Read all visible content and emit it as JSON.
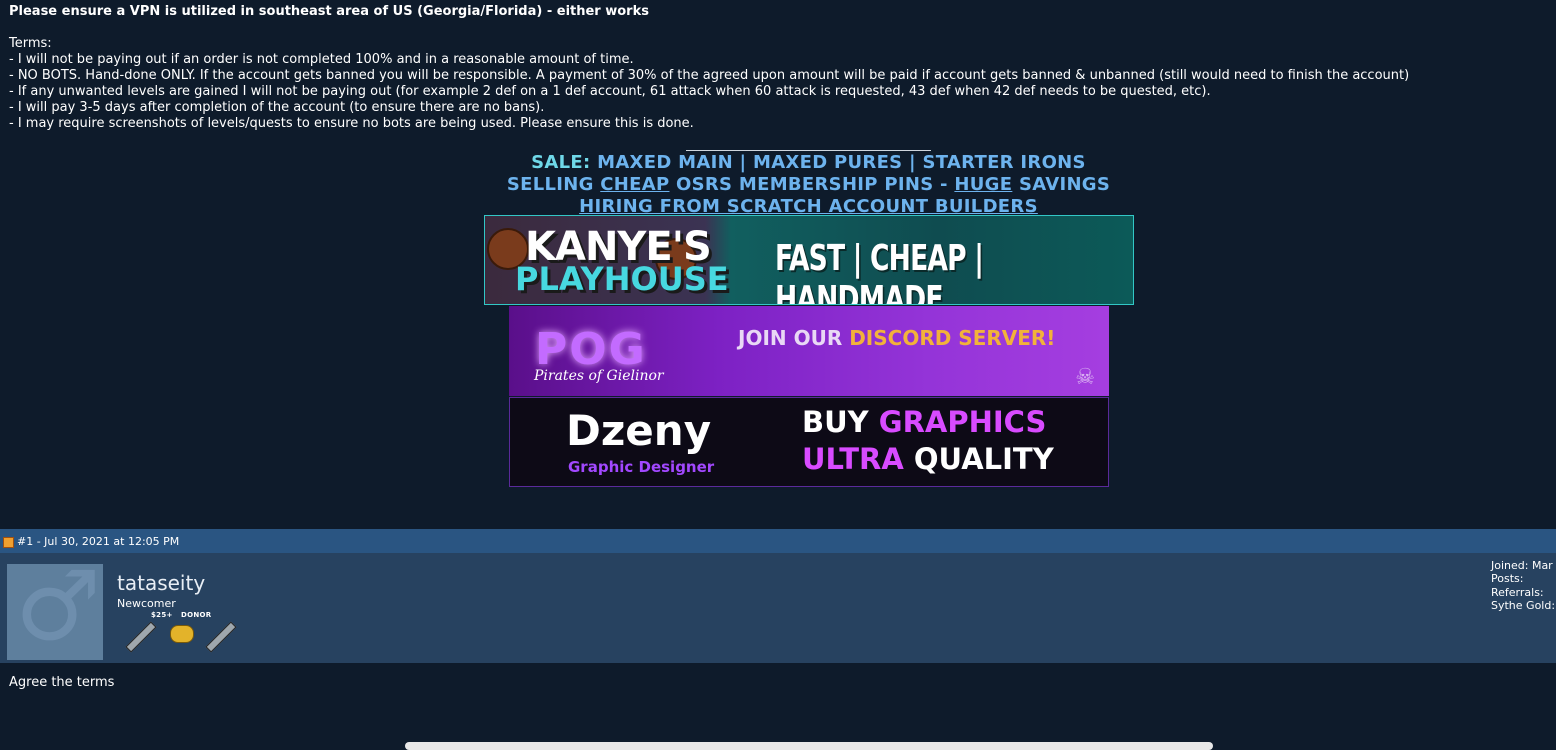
{
  "post": {
    "vpn_notice": "Please ensure a VPN is utilized in southeast area of US (Georgia/Florida) - either works",
    "terms_heading": "Terms:",
    "terms": [
      "- I will not be paying out if an order is not completed 100% and in a reasonable amount of time.",
      "- NO BOTS. Hand-done ONLY. If the account gets banned you will be responsible. A payment of 30% of the agreed upon amount will be paid if account gets banned & unbanned (still would need to finish the account)",
      "- If any unwanted levels are gained I will not be paying out (for example 2 def on a 1 def account, 61 attack when 60 attack is requested, 43 def when 42 def needs to be quested, etc).",
      "- I will pay 3-5 days after completion of the account (to ensure there are no bans).",
      "- I may require screenshots of levels/quests to ensure no bots are being used. Please ensure this is done."
    ]
  },
  "signature": {
    "line1": {
      "sale": "SALE:",
      "maxed_main": "MAXED MAIN",
      "sep1": "|",
      "maxed_pures": "MAXED PURES",
      "sep2": "|",
      "starter_irons": "STARTER IRONS"
    },
    "line2": {
      "selling": "SELLING",
      "cheap": "CHEAP",
      "osrs": "OSRS MEMBERSHIP PINS -",
      "huge": "HUGE",
      "savings": "SAVINGS"
    },
    "line3": "HIRING FROM SCRATCH ACCOUNT BUILDERS",
    "banner_kanye": {
      "logo_top": "KANYE'S",
      "logo_bottom": "PLAYHOUSE",
      "tagline": "FAST | CHEAP | HANDMADE"
    },
    "banner_pog": {
      "logo": "POG",
      "subtitle": "Pirates of Gielinor",
      "join_prefix": "JOIN OUR",
      "join_highlight": "DISCORD SERVER!"
    },
    "banner_dzeny": {
      "logo": "Dzeny",
      "subtitle": "Graphic Designer",
      "line1_plain": "BUY",
      "line1_highlight": "GRAPHICS",
      "line2_highlight": "ULTRA",
      "line2_plain": "QUALITY"
    }
  },
  "reply_post": {
    "meta": "#1 - Jul 30, 2021 at 12:05 PM",
    "username": "tataseity",
    "rank": "Newcomer",
    "badges": {
      "donor_amount": "$25+",
      "donor_label": "DONOR"
    },
    "stats": {
      "joined": "Joined: Mar",
      "posts": "Posts:",
      "referrals": "Referrals:",
      "gold": "Sythe Gold:"
    },
    "content": "Agree the terms"
  }
}
